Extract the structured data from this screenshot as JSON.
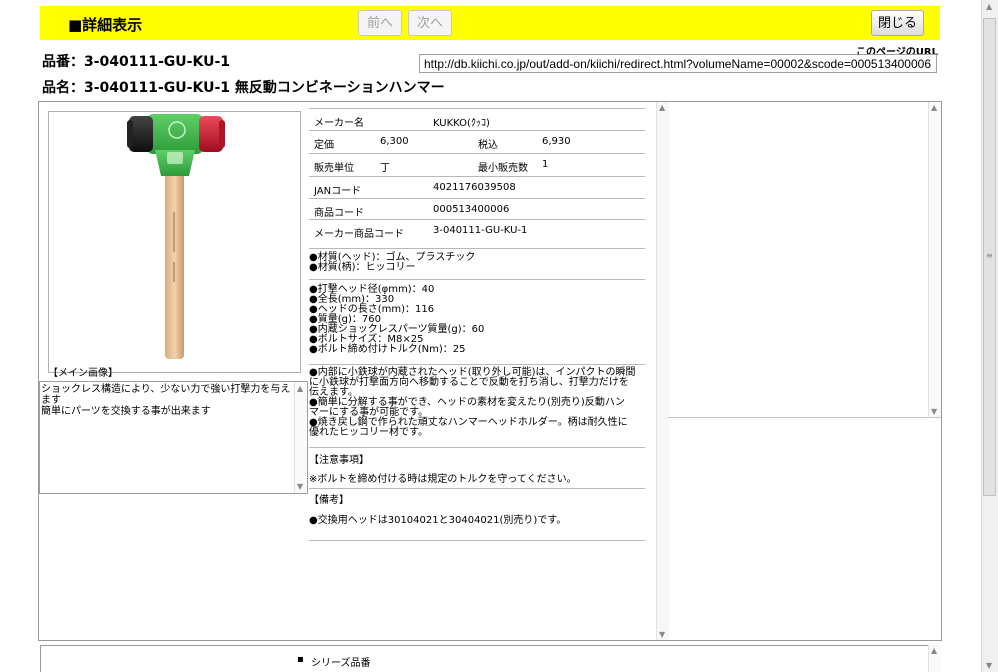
{
  "toolbar": {
    "title": "■詳細表示",
    "prev_label": "前へ",
    "next_label": "次へ",
    "close_label": "閉じる"
  },
  "header": {
    "product_number": "品番：3-040111-GU-KU-1",
    "product_name": "品名：3-040111-GU-KU-1 無反動コンビネーションハンマー",
    "page_url_label": "このページのURL",
    "page_url": "http://db.kiichi.co.jp/out/add-on/kiichi/redirect.html?volumeName=00002&scode=000513400006"
  },
  "image": {
    "caption": "【メイン画像】"
  },
  "description": {
    "lines": [
      "ショックレス構造により、少ない力で強い打撃力を与えます",
      "簡単にパーツを交換する事が出来ます"
    ]
  },
  "specs": {
    "maker_label": "メーカー名",
    "maker_value": "KUKKO(ｸｯｺ)",
    "price_label": "定価",
    "price_value": "6,300",
    "tax_label": "税込",
    "tax_value": "6,930",
    "unit_label": "販売単位",
    "unit_value": "丁",
    "min_label": "最小販売数",
    "min_value": "1",
    "jan_label": "JANコード",
    "jan_value": "4021176039508",
    "code_label": "商品コード",
    "code_value": "000513400006",
    "maker_code_label": "メーカー商品コード",
    "maker_code_value": "3-040111-GU-KU-1"
  },
  "material": [
    "●材質(ヘッド)：ゴム、プラスチック",
    "●材質(柄)：ヒッコリー"
  ],
  "dimensions": [
    "●打撃ヘッド径(φmm)：40",
    "●全長(mm)：330",
    "●ヘッドの長さ(mm)：116",
    "●質量(g)：760",
    "●内蔵ショックレスパーツ質量(g)：60",
    "●ボルトサイズ：M8×25",
    "●ボルト締め付けトルク(Nm)：25"
  ],
  "features": [
    "●内部に小鉄球が内蔵されたヘッド(取り外し可能)は、インパクトの瞬間",
    "に小鉄球が打撃面方向へ移動することで反動を打ち消し、打撃力だけを",
    "伝えます。",
    "●簡単に分解する事ができ、ヘッドの素材を変えたり(別売り)反動ハン",
    "マーにする事が可能です。",
    "●焼き戻し鋼で作られた頑丈なハンマーヘッドホルダー。柄は耐久性に",
    "優れたヒッコリー材です。"
  ],
  "caution": {
    "title": "【注意事項】",
    "text": "※ボルトを締め付ける時は規定のトルクを守ってください。"
  },
  "remarks": {
    "title": "【備考】",
    "text": "●交換用ヘッドは30104021と30404021(別売り)です。"
  },
  "series": {
    "label": "シリーズ品番"
  },
  "colors": {
    "toolbar_bg": "#ffff00",
    "hammer_green": "#3db54a",
    "head_red": "#c8102e",
    "head_black": "#1a1a1a",
    "handle_wood": "#e6c29a"
  }
}
